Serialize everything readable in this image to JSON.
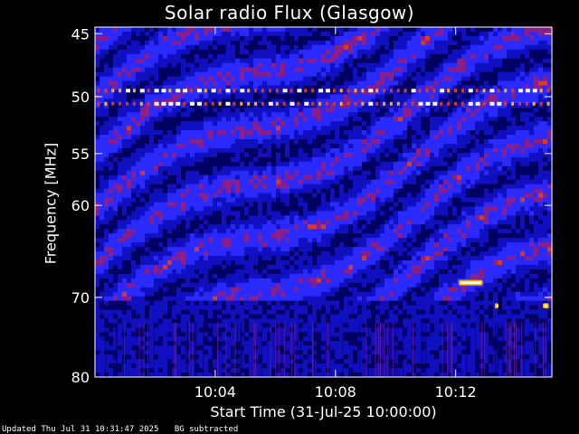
{
  "chart_data": {
    "type": "heatmap",
    "title": "Solar radio Flux (Glasgow)",
    "xlabel": "Start Time (31-Jul-25 10:00:00)",
    "ylabel": "Frequency [MHz]",
    "x_range_minutes": [
      0,
      15.2
    ],
    "x_ticks": [
      {
        "minute": 4,
        "label": "10:04"
      },
      {
        "minute": 8,
        "label": "10:08"
      },
      {
        "minute": 12,
        "label": "10:12"
      }
    ],
    "y_range_mhz": [
      44.5,
      80
    ],
    "y_scale": "log (frequency increases downward)",
    "y_ticks": [
      {
        "mhz": 45,
        "label": "45"
      },
      {
        "mhz": 50,
        "label": "50"
      },
      {
        "mhz": 55,
        "label": "55"
      },
      {
        "mhz": 60,
        "label": "60"
      },
      {
        "mhz": 70,
        "label": "70"
      },
      {
        "mhz": 80,
        "label": "80"
      }
    ],
    "colormap": [
      "#000060",
      "#1010c0",
      "#2a2aff",
      "#8a1f8a",
      "#d8392a",
      "#ffb000",
      "#ffffff"
    ],
    "features": [
      {
        "kind": "interference-line",
        "mhz": 49.5,
        "from_min": 0,
        "to_min": 15.2
      },
      {
        "kind": "interference-line",
        "mhz": 50.6,
        "from_min": 0,
        "to_min": 15.2
      },
      {
        "kind": "interference-spot",
        "mhz": 68.3,
        "from_min": 12.1,
        "to_min": 12.9
      },
      {
        "kind": "interference-spot",
        "mhz": 71.0,
        "from_min": 13.3,
        "to_min": 13.4
      },
      {
        "kind": "interference-spot",
        "mhz": 71.0,
        "from_min": 14.9,
        "to_min": 15.1
      }
    ]
  },
  "footer": {
    "updated": "Updated Thu Jul 31 10:31:47 2025",
    "note": "BG subtracted"
  },
  "colors": {
    "background": "#000000",
    "text": "#ffffff",
    "axis": "#ffffff"
  }
}
